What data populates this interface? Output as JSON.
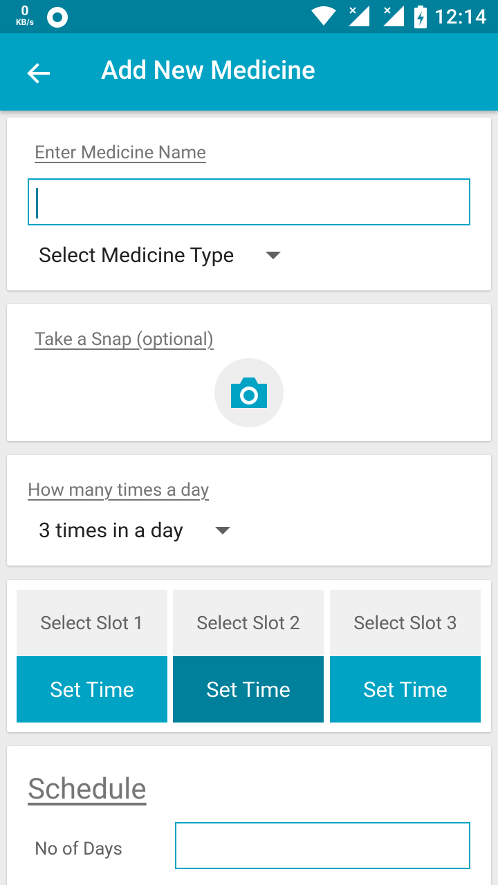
{
  "status_bar": {
    "speed_value": "0",
    "speed_unit": "KB/s",
    "time": "12:14",
    "icons": [
      "circle-notification-icon",
      "wifi-icon",
      "signal-x-icon",
      "signal-x-icon",
      "battery-charging-icon"
    ]
  },
  "app_bar": {
    "title": "Add New Medicine",
    "back_icon": "arrow-back-icon"
  },
  "medicine": {
    "name_label": "Enter Medicine Name",
    "name_value": "",
    "type_selected": "Select Medicine Type"
  },
  "snap": {
    "label": "Take a Snap (optional)",
    "icon": "camera-icon"
  },
  "frequency": {
    "label": "How many times a day",
    "selected": "3 times in a day"
  },
  "slots": [
    {
      "label": "Select Slot 1",
      "button": "Set Time",
      "color": "#00a3c4"
    },
    {
      "label": "Select Slot 2",
      "button": "Set Time",
      "color": "#00809b"
    },
    {
      "label": "Select Slot 3",
      "button": "Set Time",
      "color": "#00a3c4"
    }
  ],
  "schedule": {
    "title": "Schedule",
    "days_label": "No of Days",
    "days_value": ""
  },
  "colors": {
    "status_bar": "#00809b",
    "primary": "#00a3c4",
    "primary_dark": "#00809b"
  }
}
